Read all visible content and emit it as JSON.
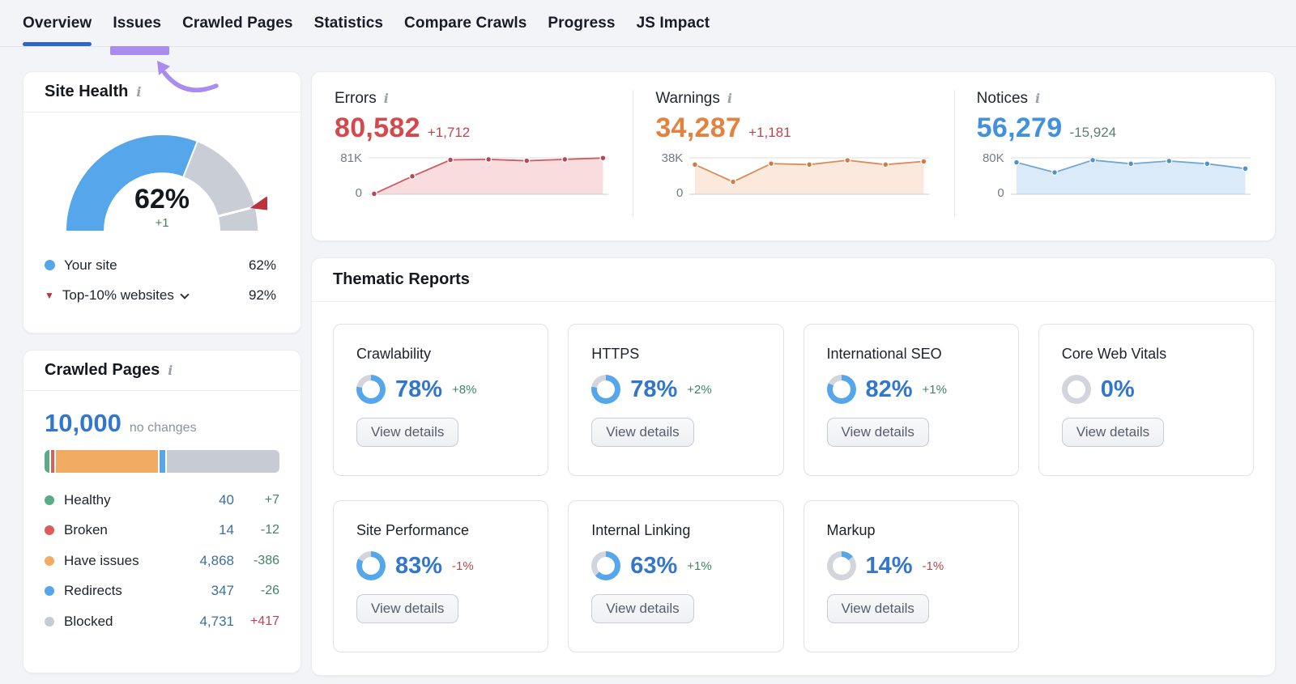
{
  "colors": {
    "accent_blue": "#2e66c4",
    "annot_purple": "#a98ced",
    "gauge_blue": "#55a6ea",
    "gauge_gray": "#c9cdd6",
    "benchmark_red": "#b9353e",
    "delta_good": "#3f8463",
    "delta_bad": "#bb4450",
    "link_blue": "#3277cc",
    "legend_value_blue": "#3d6f9f",
    "ring_track": "#d2d5db",
    "ring_fill": "#55a6ea"
  },
  "icons": {
    "info": "i",
    "benchmark_marker": "▼"
  },
  "nav": {
    "tabs": [
      {
        "label": "Overview",
        "active": true
      },
      {
        "label": "Issues",
        "highlighted": true
      },
      {
        "label": "Crawled Pages"
      },
      {
        "label": "Statistics"
      },
      {
        "label": "Compare Crawls"
      },
      {
        "label": "Progress"
      },
      {
        "label": "JS Impact"
      }
    ]
  },
  "site_health": {
    "title": "Site Health",
    "score": "62%",
    "delta": "+1",
    "legend": [
      {
        "label": "Your site",
        "value": "62%",
        "marker_color": "#55a6ea"
      },
      {
        "label": "Top-10% websites",
        "value": "92%",
        "marker_color": "#b9353e",
        "expandable": true
      }
    ]
  },
  "crawled_pages": {
    "title": "Crawled Pages",
    "total": "10,000",
    "note": "no changes",
    "bar_segments": [
      {
        "name": "Healthy",
        "color": "#58ab85",
        "pct": 2.1
      },
      {
        "name": "Broken",
        "color": "#dd5b5b",
        "pct": 1.5
      },
      {
        "name": "Have issues",
        "color": "#f2ab62",
        "pct": 44.5
      },
      {
        "name": "Redirects",
        "color": "#55a6ea",
        "pct": 2.5
      },
      {
        "name": "Blocked",
        "color": "#c7cbd3",
        "pct": 49.4
      }
    ],
    "legend": [
      {
        "label": "Healthy",
        "value": "40",
        "delta": "+7",
        "delta_tone": "good"
      },
      {
        "label": "Broken",
        "value": "14",
        "delta": "-12",
        "delta_tone": "good"
      },
      {
        "label": "Have issues",
        "value": "4,868",
        "delta": "-386",
        "delta_tone": "good"
      },
      {
        "label": "Redirects",
        "value": "347",
        "delta": "-26",
        "delta_tone": "good"
      },
      {
        "label": "Blocked",
        "value": "4,731",
        "delta": "+417",
        "delta_tone": "bad"
      }
    ]
  },
  "metrics": [
    {
      "title": "Errors",
      "value": "80,582",
      "delta": "+1,712",
      "delta_tone": "bad",
      "y_top_label": "81K",
      "y_bottom_label": "0",
      "value_color": "#d5494c",
      "line_color": "#cd5a5e",
      "dot_color": "#bb4450",
      "fill_color": "#f9dcdd"
    },
    {
      "title": "Warnings",
      "value": "34,287",
      "delta": "+1,181",
      "delta_tone": "bad",
      "y_top_label": "38K",
      "y_bottom_label": "0",
      "value_color": "#e5813e",
      "line_color": "#dd8a55",
      "dot_color": "#d4793f",
      "fill_color": "#fae9dc"
    },
    {
      "title": "Notices",
      "value": "56,279",
      "delta": "-15,924",
      "delta_tone": "muted-good",
      "y_top_label": "80K",
      "y_bottom_label": "0",
      "value_color": "#4191dc",
      "line_color": "#6fa8d4",
      "dot_color": "#4e93cc",
      "fill_color": "#daeaf8"
    }
  ],
  "thematic": {
    "title": "Thematic Reports",
    "button_label": "View details",
    "cards": [
      {
        "title": "Crawlability",
        "pct": "78%",
        "pct_value": 78,
        "delta": "+8%",
        "delta_tone": "good"
      },
      {
        "title": "HTTPS",
        "pct": "78%",
        "pct_value": 78,
        "delta": "+2%",
        "delta_tone": "good"
      },
      {
        "title": "International SEO",
        "pct": "82%",
        "pct_value": 82,
        "delta": "+1%",
        "delta_tone": "good"
      },
      {
        "title": "Core Web Vitals",
        "pct": "0%",
        "pct_value": 0,
        "delta": "",
        "delta_tone": "good"
      },
      {
        "title": "Site Performance",
        "pct": "83%",
        "pct_value": 83,
        "delta": "-1%",
        "delta_tone": "bad"
      },
      {
        "title": "Internal Linking",
        "pct": "63%",
        "pct_value": 63,
        "delta": "+1%",
        "delta_tone": "good"
      },
      {
        "title": "Markup",
        "pct": "14%",
        "pct_value": 14,
        "delta": "-1%",
        "delta_tone": "bad"
      }
    ]
  },
  "chart_data": [
    {
      "id": "site-health-gauge",
      "type": "gauge",
      "title": "Site Health",
      "value": 62,
      "delta": "+1",
      "benchmark": 92,
      "max": 100,
      "series": [
        {
          "name": "Your site",
          "value": 62
        },
        {
          "name": "Top-10% websites",
          "value": 92
        }
      ]
    },
    {
      "id": "errors-trend",
      "type": "area",
      "title": "Errors",
      "ylim": [
        0,
        81000
      ],
      "values": [
        1000,
        40000,
        76500,
        77500,
        74500,
        77500,
        80582
      ]
    },
    {
      "id": "warnings-trend",
      "type": "area",
      "title": "Warnings",
      "ylim": [
        0,
        38000
      ],
      "values": [
        31000,
        13000,
        32000,
        31000,
        35500,
        31000,
        34287
      ]
    },
    {
      "id": "notices-trend",
      "type": "area",
      "title": "Notices",
      "ylim": [
        0,
        80000
      ],
      "values": [
        70000,
        48000,
        75000,
        67000,
        73000,
        67000,
        56279
      ]
    },
    {
      "id": "crawled-pages-bar",
      "type": "bar",
      "title": "Crawled Pages",
      "categories": [
        "Healthy",
        "Broken",
        "Have issues",
        "Redirects",
        "Blocked"
      ],
      "values": [
        40,
        14,
        4868,
        347,
        4731
      ],
      "total": 10000
    },
    {
      "id": "thematic-donuts",
      "type": "pie",
      "title": "Thematic Reports scores",
      "categories": [
        "Crawlability",
        "HTTPS",
        "International SEO",
        "Core Web Vitals",
        "Site Performance",
        "Internal Linking",
        "Markup"
      ],
      "values": [
        78,
        78,
        82,
        0,
        83,
        63,
        14
      ]
    }
  ]
}
